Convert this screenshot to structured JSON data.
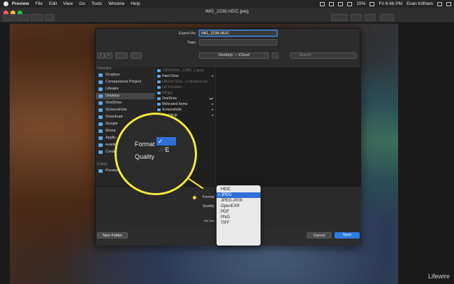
{
  "menubar": {
    "app": "Preview",
    "items": [
      "File",
      "Edit",
      "View",
      "Go",
      "Tools",
      "Window",
      "Help"
    ],
    "battery": "15%",
    "time": "Fri 6:46 PM",
    "user": "Evan Killham"
  },
  "window": {
    "title": "IMG_2238.HEIC.jpeg"
  },
  "sheet": {
    "export_as_label": "Export As:",
    "export_as_value": "IMG_2238.HEIC",
    "tags_label": "Tags:",
    "location": "Desktop — iCloud",
    "search_placeholder": "Search",
    "sidebar": {
      "favorites_header": "Favorites",
      "favorites": [
        "Dropbox",
        "Comparisons Project",
        "Lifewire",
        "Desktop",
        "OneDrive",
        "Screenshots",
        "Download",
        "Google",
        "Movie",
        "Applic",
        "evankil",
        "Creative C"
      ],
      "icloud_header": "iCloud",
      "icloud": [
        "Preview"
      ]
    },
    "files": [
      {
        "name": "105656464...13957_n.jpeg",
        "dim": true,
        "folder": false
      },
      {
        "name": "Hard Drive",
        "dim": false,
        "folder": true
      },
      {
        "name": "Lifewire Scre...s Updated.xlsx",
        "dim": true,
        "folder": false
      },
      {
        "name": "LW Priorities",
        "dim": true,
        "folder": false
      },
      {
        "name": "OP.jpg",
        "dim": true,
        "folder": false
      },
      {
        "name": "OneDrive",
        "dim": false,
        "folder": true
      },
      {
        "name": "Relocated Items",
        "dim": false,
        "folder": true
      },
      {
        "name": "Screenshots",
        "dim": false,
        "folder": true
      },
      {
        "name": "SketchUp",
        "dim": false,
        "folder": true
      }
    ],
    "format_label": "Format",
    "quality_label": "Quality",
    "file_size_label": "File Size",
    "format_menu": [
      "HEIC",
      "JPEG",
      "JPEG-2000",
      "OpenEXR",
      "PDF",
      "PNG",
      "TIFF"
    ],
    "format_selected": "JPEG",
    "new_folder": "New Folder",
    "cancel": "Cancel",
    "save": "Save"
  },
  "magnifier": {
    "format_label": "Format",
    "quality_label": "Quality",
    "items": [
      "HEI",
      "JPE",
      "JP"
    ]
  },
  "watermark": "Lifewire",
  "colors": {
    "callout": "#f5ea3b",
    "accent": "#2f7ce8",
    "selection": "#2f6fd6"
  }
}
